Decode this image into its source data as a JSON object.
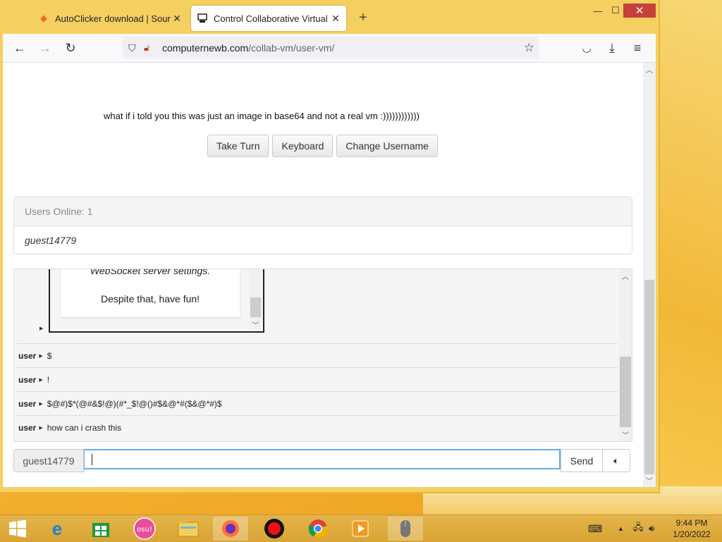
{
  "browser": {
    "tabs": [
      {
        "title": "AutoClicker download | SourceForge",
        "icon": "sourceforge-icon"
      },
      {
        "title": "Control Collaborative Virtual Machines",
        "icon": "computer-icon"
      }
    ],
    "url_host": "computernewb.com",
    "url_path": "/collab-vm/user-vm/"
  },
  "page": {
    "message": "what if i told you this was just an image in base64 and not a real vm :))))))))))))",
    "buttons": {
      "take_turn": "Take Turn",
      "keyboard": "Keyboard",
      "change_username": "Change Username"
    },
    "users_online_label": "Users Online: 1",
    "users": [
      "guest14779"
    ],
    "motd_line1": "WebSocket server settings.",
    "motd_line2": "Despite that, have fun!",
    "chat": [
      {
        "user": "user",
        "text": "$"
      },
      {
        "user": "user",
        "text": "!"
      },
      {
        "user": "user",
        "text": "$@#)$*(@#&$!@)(#*_$!@()#$&@*#($&@*#)$"
      },
      {
        "user": "user",
        "text": "how can i crash this"
      }
    ],
    "username": "guest14779",
    "chat_input_value": "",
    "send_label": "Send"
  },
  "taskbar": {
    "time": "9:44 PM",
    "date": "1/20/2022"
  },
  "colors": {
    "close_red": "#c7403a",
    "focus_blue": "#66afe9",
    "desktop": "#f3b532"
  }
}
